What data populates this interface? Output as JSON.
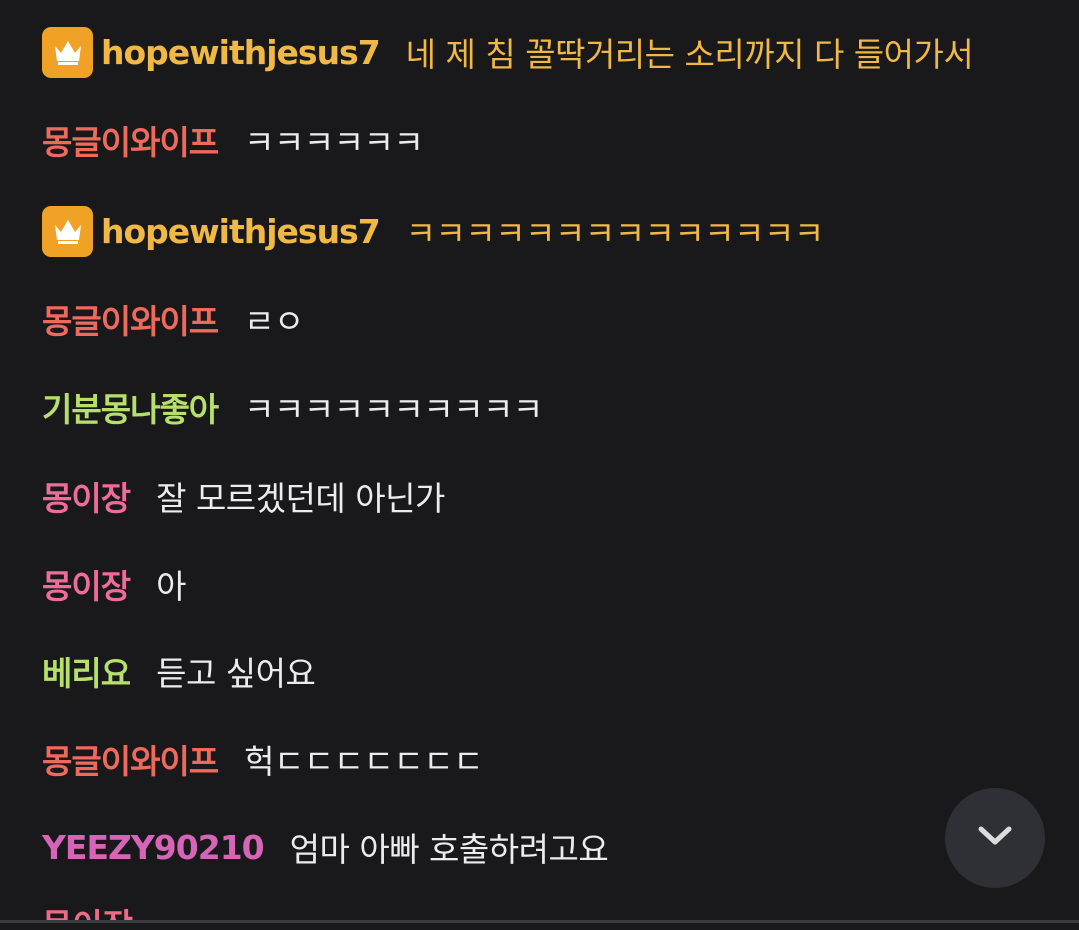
{
  "chat": {
    "messages": [
      {
        "user": "hopewithjesus7",
        "text": "네 제 침 꼴딱거리는 소리까지 다 들어가서",
        "user_color": "#f0b844",
        "text_color": "#f0b844",
        "badge": "crown-icon"
      },
      {
        "user": "몽글이와이프",
        "text": "ㅋㅋㅋㅋㅋㅋ",
        "user_color": "#f06a5c",
        "text_color": "#ececec",
        "badge": null
      },
      {
        "user": "hopewithjesus7",
        "text": "ㅋㅋㅋㅋㅋㅋㅋㅋㅋㅋㅋㅋㅋㅋ",
        "user_color": "#f0b844",
        "text_color": "#f0b844",
        "badge": "crown-icon"
      },
      {
        "user": "몽글이와이프",
        "text": "ㄹㅇ",
        "user_color": "#f06a5c",
        "text_color": "#ececec",
        "badge": null
      },
      {
        "user": "기분몽나좋아",
        "text": "ㅋㅋㅋㅋㅋㅋㅋㅋㅋㅋ",
        "user_color": "#b6e06b",
        "text_color": "#ececec",
        "badge": null
      },
      {
        "user": "몽이장",
        "text": "잘 모르겠던데 아닌가",
        "user_color": "#ee6b9a",
        "text_color": "#ececec",
        "badge": null
      },
      {
        "user": "몽이장",
        "text": "아",
        "user_color": "#ee6b9a",
        "text_color": "#ececec",
        "badge": null
      },
      {
        "user": "베리요",
        "text": "듣고 싶어요",
        "user_color": "#b6e06b",
        "text_color": "#ececec",
        "badge": null
      },
      {
        "user": "몽글이와이프",
        "text": "헉ㄷㄷㄷㄷㄷㄷㄷ",
        "user_color": "#f06a5c",
        "text_color": "#ececec",
        "badge": null
      },
      {
        "user": "YEEZY90210",
        "text": "엄마 아빠 호출하려고요",
        "user_color": "#d764b8",
        "text_color": "#ececec",
        "badge": null
      }
    ],
    "partial_user": "몽이장"
  },
  "scroll_button": {
    "icon": "chevron-down-icon"
  },
  "colors": {
    "background": "#19191b",
    "badge": "#f0a227",
    "scroll_button": "#2f3035"
  }
}
